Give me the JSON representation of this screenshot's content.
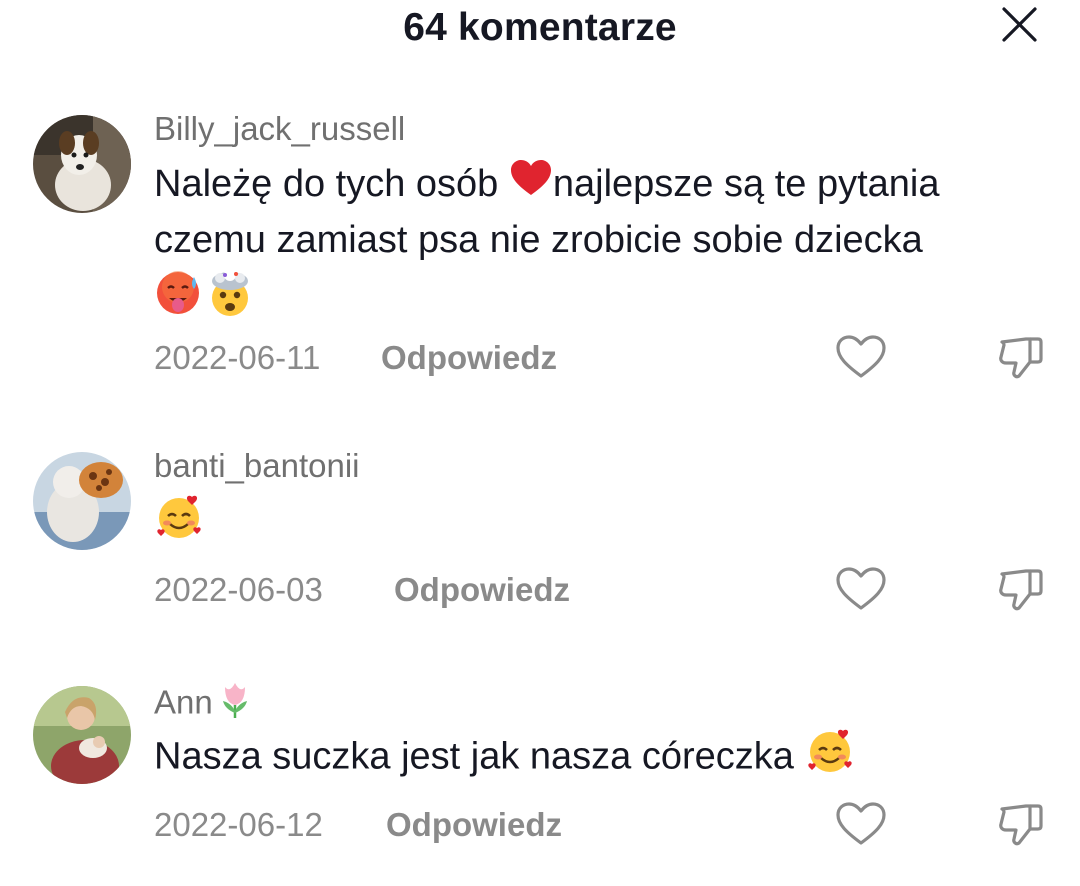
{
  "header": {
    "title": "64 komentarze",
    "close_icon": "close-icon"
  },
  "comments": [
    {
      "username": "Billy_jack_russell",
      "text_lines": [
        "Należę do tych osób ",
        "najlepsze są te pytania",
        "czemu zamiast psa nie zrobicie sobie dziecka"
      ],
      "emojis": [
        "red-heart-emoji",
        "hot-face-emoji",
        "exploding-head-emoji"
      ],
      "date": "2022-06-11",
      "reply_label": "Odpowiedz"
    },
    {
      "username": "banti_bantonii",
      "text_lines": [],
      "emojis": [
        "smiling-face-with-hearts-emoji"
      ],
      "date": "2022-06-03",
      "reply_label": "Odpowiedz"
    },
    {
      "username": "Ann",
      "username_emoji": "tulip-emoji",
      "text_lines": [
        "Nasza suczka jest jak nasza córeczka "
      ],
      "emojis": [
        "smiling-face-with-hearts-emoji"
      ],
      "date": "2022-06-12",
      "reply_label": "Odpowiedz"
    }
  ],
  "colors": {
    "text_primary": "#161823",
    "text_secondary": "#707070",
    "meta": "#8a8a8a",
    "icon_stroke": "#8a8a8a",
    "background": "#ffffff"
  }
}
